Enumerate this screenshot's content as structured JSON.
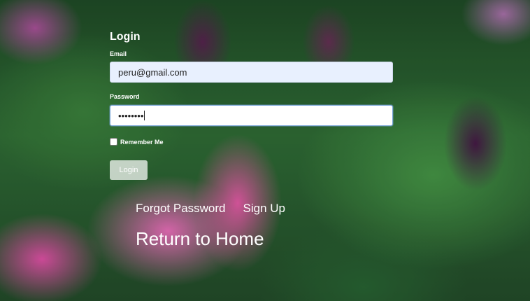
{
  "form": {
    "title": "Login",
    "email_label": "Email",
    "email_value": "peru@gmail.com",
    "password_label": "Password",
    "password_value": "••••••••",
    "remember_label": "Remember Me",
    "remember_checked": false,
    "login_button": "Login"
  },
  "links": {
    "forgot_password": "Forgot Password",
    "sign_up": "Sign Up",
    "return_home": "Return to Home"
  },
  "colors": {
    "text": "#ffffff",
    "email_field_bg": "#e8f0fe",
    "password_field_bg": "#ffffff"
  }
}
